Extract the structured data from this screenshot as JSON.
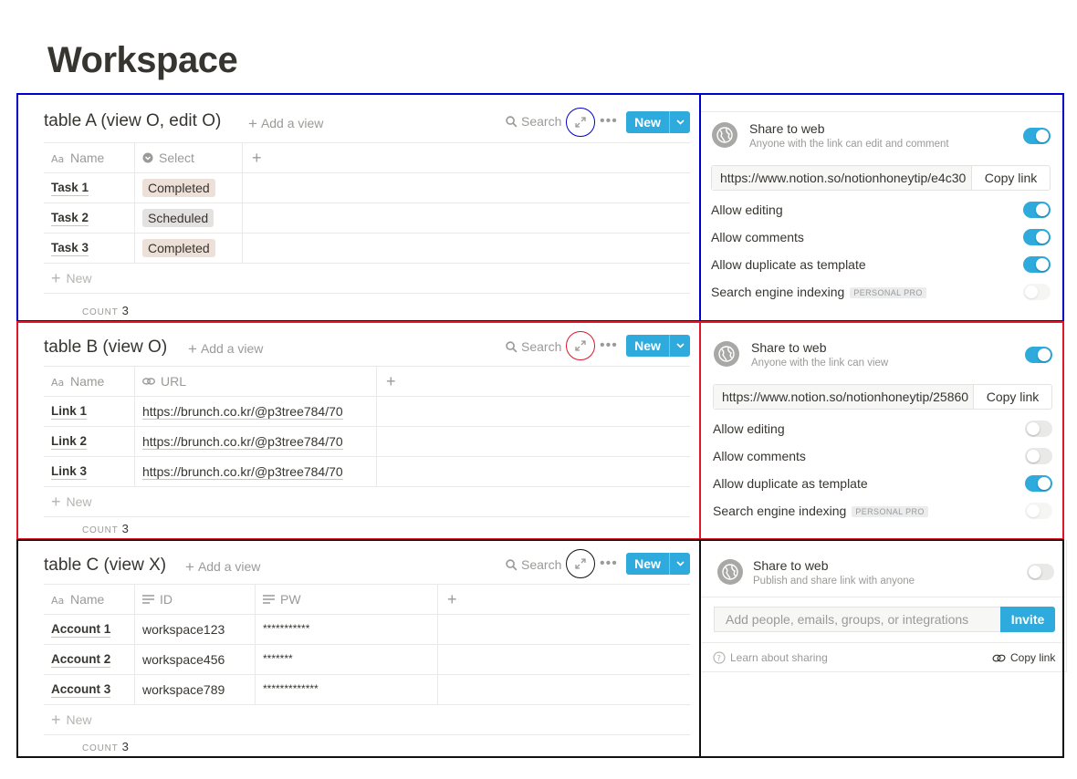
{
  "page": {
    "title": "Workspace"
  },
  "colors": {
    "blue_frame": "#0000cc",
    "red_frame": "#e0162b",
    "black_frame": "#111111",
    "accent": "#2eaadc",
    "tag_completed_bg": "#ede0d8",
    "tag_scheduled_bg": "#e3e2e0"
  },
  "toolbar": {
    "add_view": "Add a view",
    "search": "Search",
    "new_button": "New",
    "more": "•••"
  },
  "table_a": {
    "title": "table A (view O, edit O)",
    "columns": [
      {
        "label": "Name",
        "icon": "text-aa-icon"
      },
      {
        "label": "Select",
        "icon": "select-chevron-icon"
      },
      {
        "label": "+"
      }
    ],
    "rows": [
      {
        "name": "Task 1",
        "value": "Completed",
        "tag": "completed"
      },
      {
        "name": "Task 2",
        "value": "Scheduled",
        "tag": "scheduled"
      },
      {
        "name": "Task 3",
        "value": "Completed",
        "tag": "completed"
      }
    ],
    "new_row": "New",
    "count_label": "COUNT",
    "count": "3"
  },
  "table_b": {
    "title": "table B (view O)",
    "columns": [
      {
        "label": "Name",
        "icon": "text-aa-icon"
      },
      {
        "label": "URL",
        "icon": "link-icon"
      },
      {
        "label": "+"
      }
    ],
    "rows": [
      {
        "name": "Link 1",
        "url": "https://brunch.co.kr/@p3tree784/70"
      },
      {
        "name": "Link 2",
        "url": "https://brunch.co.kr/@p3tree784/70"
      },
      {
        "name": "Link 3",
        "url": "https://brunch.co.kr/@p3tree784/70"
      }
    ],
    "new_row": "New",
    "count_label": "COUNT",
    "count": "3"
  },
  "table_c": {
    "title": "table C (view X)",
    "columns": [
      {
        "label": "Name",
        "icon": "text-aa-icon"
      },
      {
        "label": "ID",
        "icon": "text-lines-icon"
      },
      {
        "label": "PW",
        "icon": "text-lines-icon"
      },
      {
        "label": "+"
      }
    ],
    "rows": [
      {
        "name": "Account 1",
        "id": "workspace123",
        "pw": "***********"
      },
      {
        "name": "Account 2",
        "id": "workspace456",
        "pw": "*******"
      },
      {
        "name": "Account 3",
        "id": "workspace789",
        "pw": "*************"
      }
    ],
    "new_row": "New",
    "count_label": "COUNT",
    "count": "3"
  },
  "share_a": {
    "title": "Share to web",
    "subtitle": "Anyone with the link can edit and comment",
    "enabled": true,
    "url": "https://www.notion.so/notionhoneytip/e4c30",
    "copy": "Copy link",
    "options": [
      {
        "label": "Allow editing",
        "on": true
      },
      {
        "label": "Allow comments",
        "on": true
      },
      {
        "label": "Allow duplicate as template",
        "on": true
      },
      {
        "label": "Search engine indexing",
        "badge": "PERSONAL PRO",
        "on": false,
        "disabled": true
      }
    ]
  },
  "share_b": {
    "title": "Share to web",
    "subtitle": "Anyone with the link can view",
    "enabled": true,
    "url": "https://www.notion.so/notionhoneytip/25860",
    "copy": "Copy link",
    "options": [
      {
        "label": "Allow editing",
        "on": false
      },
      {
        "label": "Allow comments",
        "on": false
      },
      {
        "label": "Allow duplicate as template",
        "on": true
      },
      {
        "label": "Search engine indexing",
        "badge": "PERSONAL PRO",
        "on": false,
        "disabled": true
      }
    ]
  },
  "share_c": {
    "title": "Share to web",
    "subtitle": "Publish and share link with anyone",
    "enabled": false,
    "invite_placeholder": "Add people, emails, groups, or integrations",
    "invite": "Invite",
    "learn": "Learn about sharing",
    "copy": "Copy link"
  }
}
